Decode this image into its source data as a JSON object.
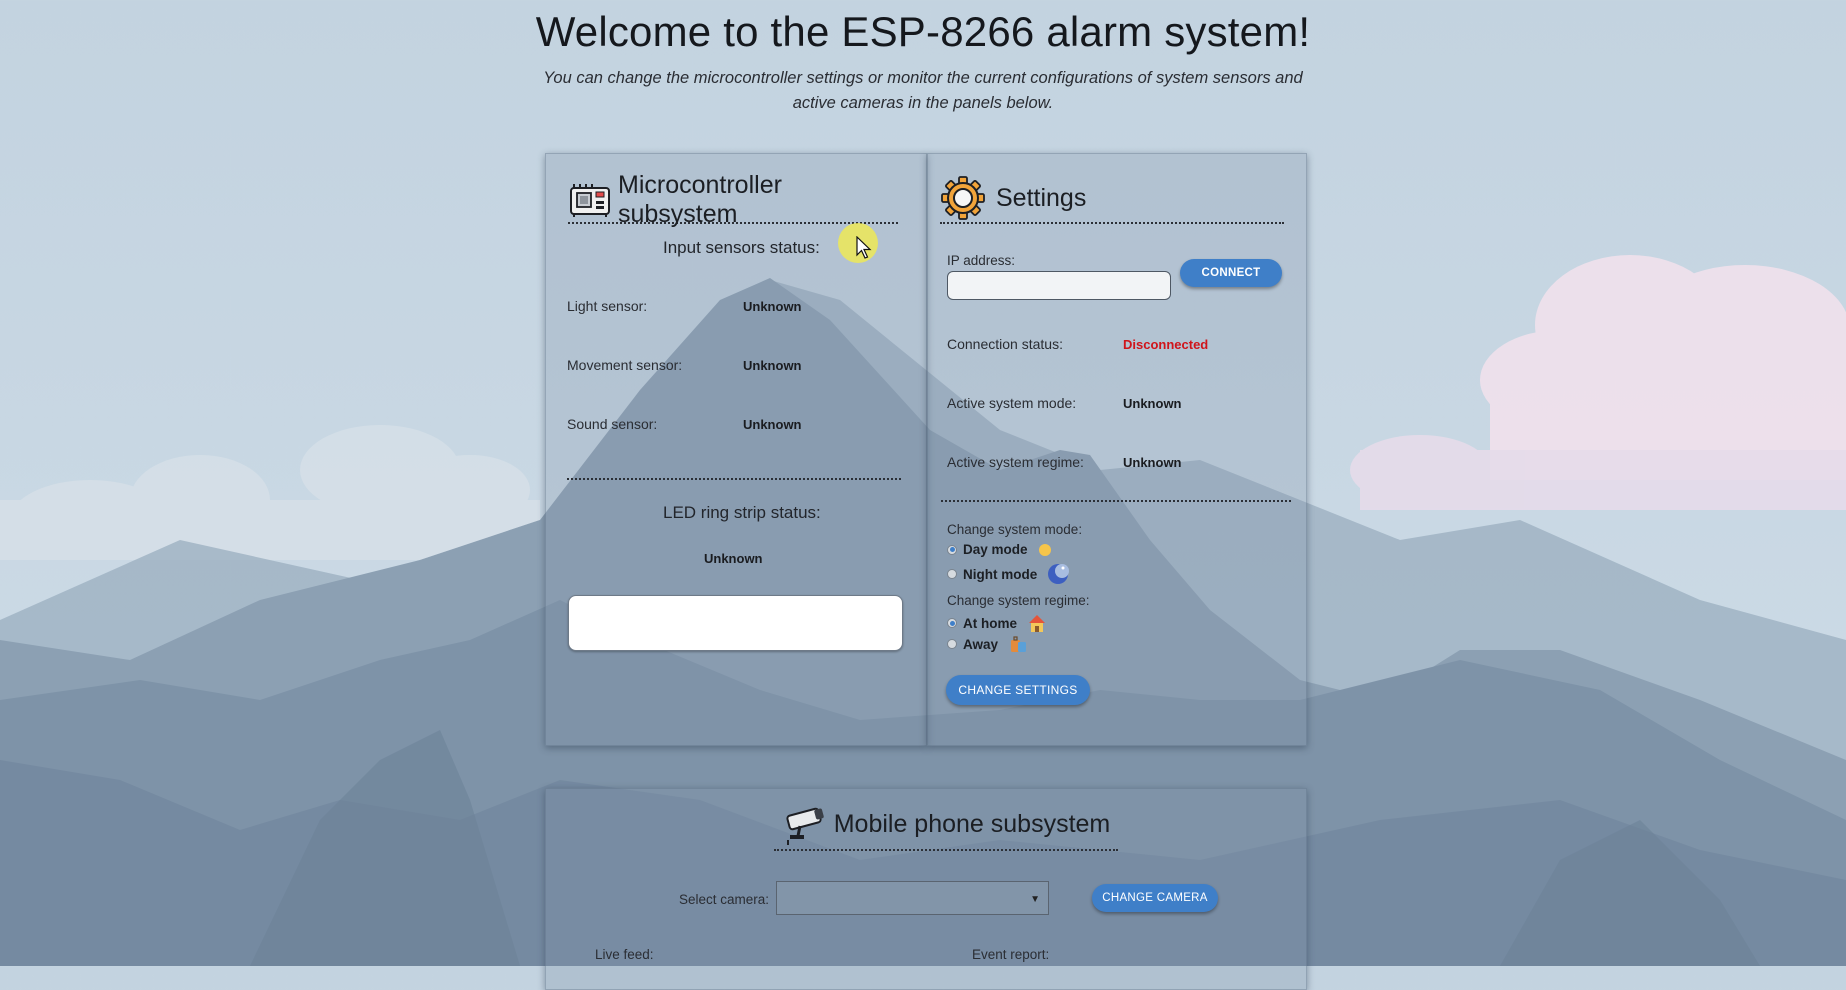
{
  "header": {
    "title": "Welcome to the ESP-8266 alarm system!",
    "subtitle": "You can change the microcontroller settings or monitor the current configurations of system sensors and active cameras in the panels below."
  },
  "microcontroller": {
    "title": "Microcontroller subsystem",
    "icon": "circuit-board-icon",
    "input_sensors_title": "Input sensors status:",
    "sensors": [
      {
        "label": "Light sensor:",
        "value": "Unknown"
      },
      {
        "label": "Movement sensor:",
        "value": "Unknown"
      },
      {
        "label": "Sound sensor:",
        "value": "Unknown"
      }
    ],
    "led_title": "LED ring strip status:",
    "led_value": "Unknown"
  },
  "settings": {
    "title": "Settings",
    "icon": "gear-icon",
    "ip_label": "IP address:",
    "ip_value": "",
    "connect_label": "CONNECT",
    "connection_status_label": "Connection status:",
    "connection_status_value": "Disconnected",
    "connection_status_color": "#d0141a",
    "active_mode_label": "Active system mode:",
    "active_mode_value": "Unknown",
    "active_regime_label": "Active system regime:",
    "active_regime_value": "Unknown",
    "change_mode_label": "Change system mode:",
    "modes": [
      {
        "label": "Day mode",
        "icon": "sun-icon",
        "checked": true
      },
      {
        "label": "Night mode",
        "icon": "moon-icon",
        "checked": false
      }
    ],
    "change_regime_label": "Change system regime:",
    "regimes": [
      {
        "label": "At home",
        "icon": "house-icon",
        "checked": true
      },
      {
        "label": "Away",
        "icon": "luggage-icon",
        "checked": false
      }
    ],
    "change_settings_label": "CHANGE SETTINGS"
  },
  "mobile": {
    "title": "Mobile phone subsystem",
    "icon": "security-camera-icon",
    "select_camera_label": "Select camera:",
    "select_camera_value": "",
    "change_camera_label": "CHANGE CAMERA",
    "live_feed_label": "Live feed:",
    "event_report_label": "Event report:"
  },
  "colors": {
    "accent": "#3f7fc8",
    "panel": "#8094a8",
    "mountain_dark": "#6f8499",
    "mountain_light": "#8fa2b5"
  }
}
